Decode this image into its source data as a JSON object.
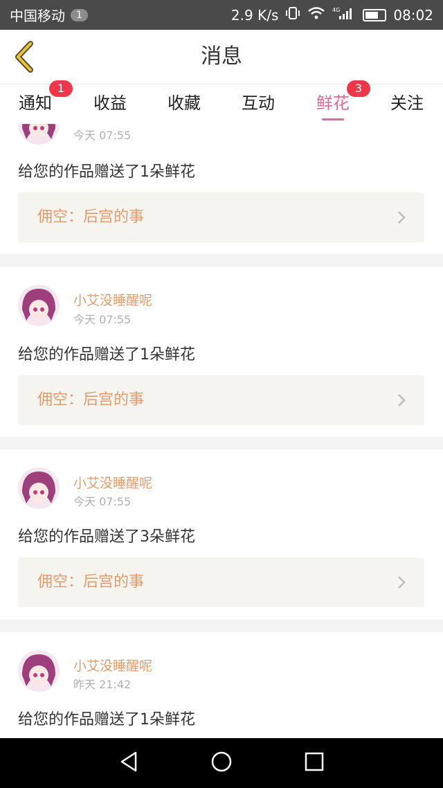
{
  "status_bar": {
    "carrier": "中国移动",
    "notif_count": "1",
    "speed": "2.9 K/s",
    "network": "4G",
    "time": "08:02"
  },
  "header": {
    "title": "消息",
    "back_icon": "chevron-left-icon"
  },
  "tabs": [
    {
      "label": "通知",
      "badge": "1",
      "active": false
    },
    {
      "label": "收益",
      "badge": "",
      "active": false
    },
    {
      "label": "收藏",
      "badge": "",
      "active": false
    },
    {
      "label": "互动",
      "badge": "",
      "active": false
    },
    {
      "label": "鲜花",
      "badge": "3",
      "active": true
    },
    {
      "label": "关注",
      "badge": "",
      "active": false
    }
  ],
  "messages": [
    {
      "username": "",
      "time": "今天 07:55",
      "text": "给您的作品赠送了1朵鲜花",
      "work": "佣空：后宫的事"
    },
    {
      "username": "小艾没睡醒呢",
      "time": "今天 07:55",
      "text": "给您的作品赠送了1朵鲜花",
      "work": "佣空：后宫的事"
    },
    {
      "username": "小艾没睡醒呢",
      "time": "今天 07:55",
      "text": "给您的作品赠送了3朵鲜花",
      "work": "佣空：后宫的事"
    },
    {
      "username": "小艾没睡醒呢",
      "time": "昨天 21:42",
      "text": "给您的作品赠送了1朵鲜花",
      "work": ""
    }
  ],
  "colors": {
    "accent": "#e5679d",
    "username": "#e39b6d",
    "badge": "#f0364b",
    "back_icon": "#e8c53a"
  }
}
